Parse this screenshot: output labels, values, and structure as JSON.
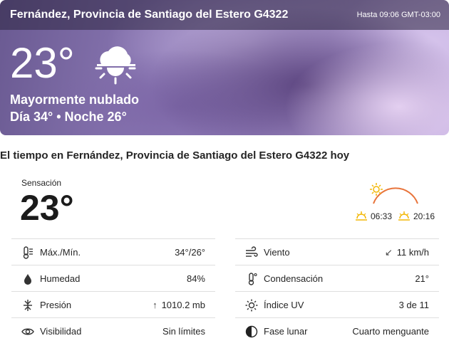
{
  "header": {
    "location": "Fernández, Provincia de Santiago del Estero G4322",
    "time": "Hasta 09:06 GMT-03:00"
  },
  "current": {
    "temp": "23°",
    "phrase": "Mayormente nublado",
    "day_night": "Día 34° • Noche 26°",
    "icon": "partly-cloudy-day-icon"
  },
  "today": {
    "heading": "El tiempo en Fernández, Provincia de Santiago del Estero G4322 hoy",
    "feels_label": "Sensación",
    "feels_value": "23°",
    "sunrise": "06:33",
    "sunset": "20:16"
  },
  "details_left": [
    {
      "label": "Máx./Mín.",
      "value": "34°/26°",
      "icon": "thermometer-icon"
    },
    {
      "label": "Humedad",
      "value": "84%",
      "icon": "humidity-drop-icon"
    },
    {
      "label": "Presión",
      "value": "1010.2 mb",
      "icon": "pressure-icon",
      "arrow": "↑"
    },
    {
      "label": "Visibilidad",
      "value": "Sin límites",
      "icon": "visibility-eye-icon"
    }
  ],
  "details_right": [
    {
      "label": "Viento",
      "value": "11 km/h",
      "icon": "wind-icon",
      "arrow": "↙"
    },
    {
      "label": "Condensación",
      "value": "21°",
      "icon": "dew-point-icon"
    },
    {
      "label": "Índice UV",
      "value": "3 de 11",
      "icon": "uv-sun-icon"
    },
    {
      "label": "Fase lunar",
      "value": "Cuarto menguante",
      "icon": "moon-phase-icon"
    }
  ],
  "colors": {
    "sun_arc": "#e8743b",
    "sun_icon": "#f2b705",
    "divider": "#dedede"
  }
}
